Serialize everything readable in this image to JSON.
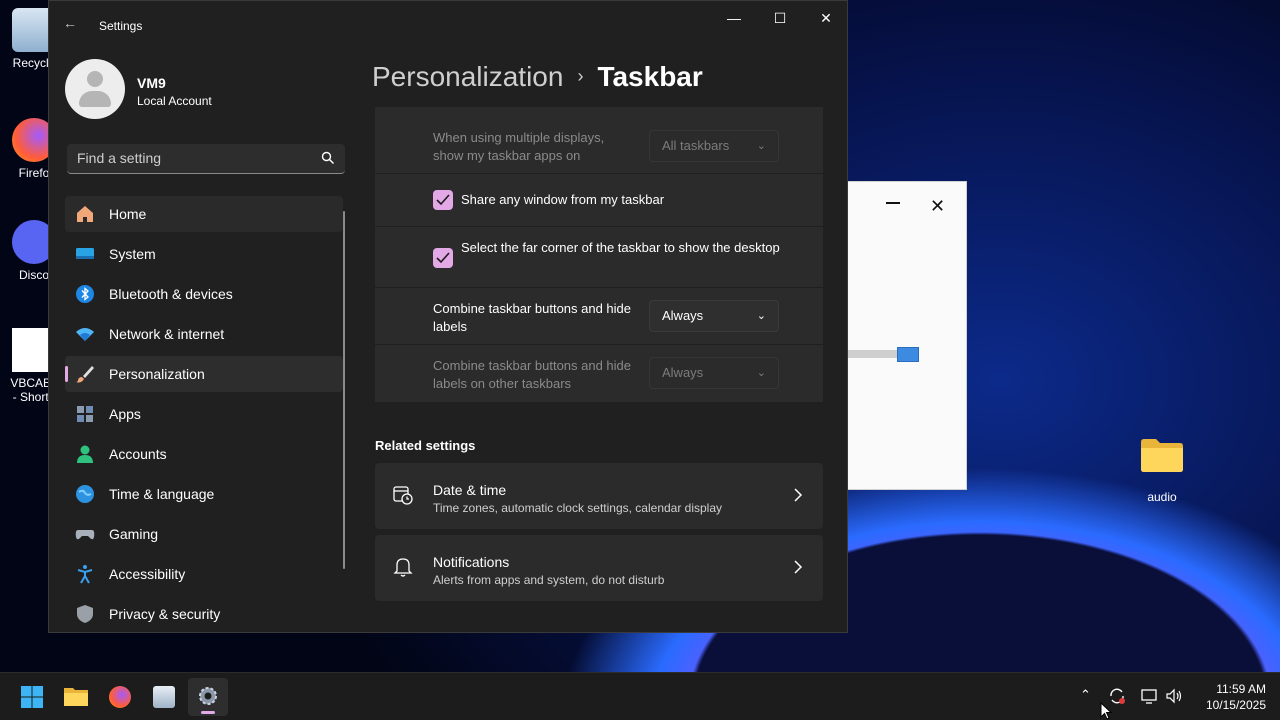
{
  "desktop": {
    "icons": [
      {
        "label": "Recycle"
      },
      {
        "label": "Firefo"
      },
      {
        "label": "Disco"
      },
      {
        "label": "VBCABL\n- Shorte"
      }
    ],
    "folder": {
      "label": "audio"
    }
  },
  "window": {
    "title": "Settings",
    "profile": {
      "name": "VM9",
      "type": "Local Account"
    },
    "search": {
      "placeholder": "Find a setting"
    },
    "nav": [
      {
        "label": "Home",
        "icon": "home-icon"
      },
      {
        "label": "System",
        "icon": "system-icon"
      },
      {
        "label": "Bluetooth & devices",
        "icon": "bluetooth-icon"
      },
      {
        "label": "Network & internet",
        "icon": "wifi-icon"
      },
      {
        "label": "Personalization",
        "icon": "brush-icon"
      },
      {
        "label": "Apps",
        "icon": "apps-icon"
      },
      {
        "label": "Accounts",
        "icon": "accounts-icon"
      },
      {
        "label": "Time & language",
        "icon": "globe-icon"
      },
      {
        "label": "Gaming",
        "icon": "gamepad-icon"
      },
      {
        "label": "Accessibility",
        "icon": "accessibility-icon"
      },
      {
        "label": "Privacy & security",
        "icon": "shield-icon"
      }
    ],
    "breadcrumb": {
      "parent": "Personalization",
      "current": "Taskbar"
    },
    "settings": {
      "multiple_displays": {
        "label": "When using multiple displays, show my taskbar apps on",
        "value": "All taskbars"
      },
      "share_window": {
        "label": "Share any window from my taskbar",
        "checked": true
      },
      "far_corner": {
        "label": "Select the far corner of the taskbar to show the desktop",
        "checked": true
      },
      "combine_buttons": {
        "label": "Combine taskbar buttons and hide labels",
        "value": "Always"
      },
      "combine_other": {
        "label": "Combine taskbar buttons and hide labels on other taskbars",
        "value": "Always"
      }
    },
    "related": {
      "heading": "Related settings",
      "items": [
        {
          "title": "Date & time",
          "subtitle": "Time zones, automatic clock settings, calendar display"
        },
        {
          "title": "Notifications",
          "subtitle": "Alerts from apps and system, do not disturb"
        }
      ]
    }
  },
  "taskbar": {
    "time": "11:59 AM",
    "date": "10/15/2025"
  },
  "colors": {
    "accent": "#e3a8e6",
    "window_bg": "#202020",
    "card_bg": "#2b2b2b"
  }
}
